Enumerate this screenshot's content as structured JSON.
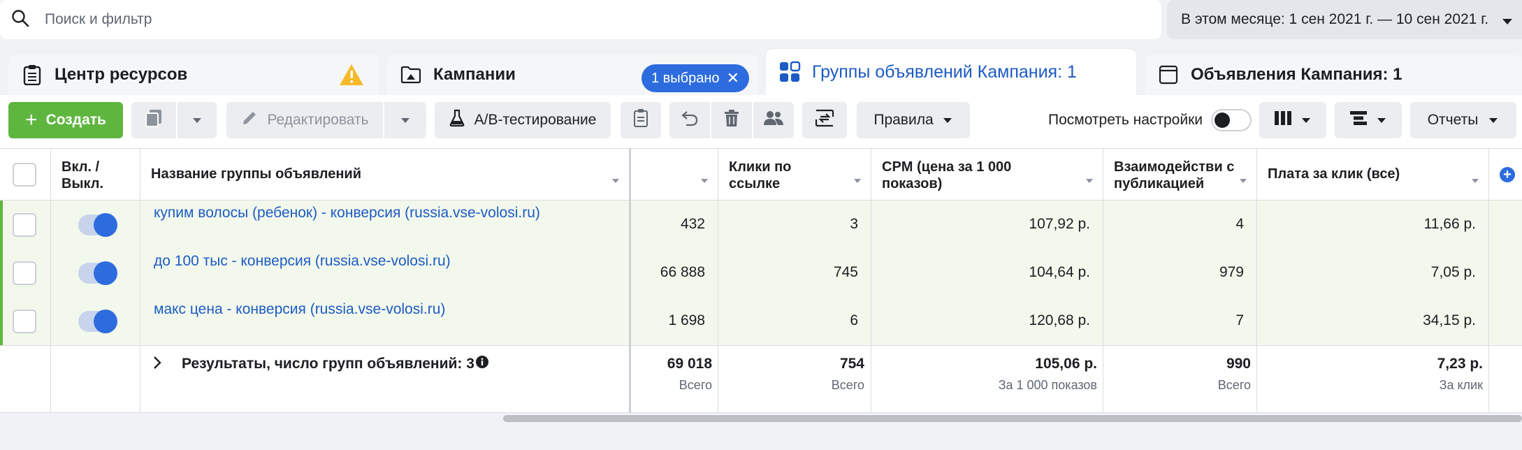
{
  "search": {
    "placeholder": "Поиск и фильтр"
  },
  "date_range": {
    "label": "В этом месяце: 1 сен 2021 г. — 10 сен 2021 г."
  },
  "tabs": [
    {
      "label": "Центр ресурсов"
    },
    {
      "label": "Кампании",
      "badge": "1 выбрано"
    },
    {
      "label": "Группы объявлений Кампания: 1"
    },
    {
      "label": "Объявления Кампания: 1"
    }
  ],
  "toolbar": {
    "create": "Создать",
    "edit": "Редактировать",
    "ab_test": "А/В-тестирование",
    "rules": "Правила",
    "view_settings": "Посмотреть настройки",
    "reports": "Отчеты"
  },
  "table": {
    "headers": {
      "toggle": "Вкл. / Выкл.",
      "name": "Название группы объявлений",
      "link_clicks": "Клики по ссылке",
      "cpm": "CPM (цена за 1 000 показов)",
      "engagement": "Взаимодействи с публикацией",
      "cpc": "Плата за клик (все)"
    },
    "rows": [
      {
        "name": "купим волосы (ребенок) - конверсия (russia.vse-volosi.ru)",
        "col1": "432",
        "link_clicks": "3",
        "cpm": "107,92 р.",
        "engagement": "4",
        "cpc": "11,66 р."
      },
      {
        "name": "до 100 тыс - конверсия (russia.vse-volosi.ru)",
        "col1": "66 888",
        "link_clicks": "745",
        "cpm": "104,64 р.",
        "engagement": "979",
        "cpc": "7,05 р."
      },
      {
        "name": "макс цена - конверсия (russia.vse-volosi.ru)",
        "col1": "1 698",
        "link_clicks": "6",
        "cpm": "120,68 р.",
        "engagement": "7",
        "cpc": "34,15 р."
      }
    ],
    "summary": {
      "label": "Результаты, число групп объявлений: 3",
      "col1": "69 018",
      "col1_sub": "Всего",
      "link_clicks": "754",
      "link_clicks_sub": "Всего",
      "cpm": "105,06 р.",
      "cpm_sub": "За 1 000 показов",
      "engagement": "990",
      "engagement_sub": "Всего",
      "cpc": "7,23 р.",
      "cpc_sub": "За клик"
    }
  }
}
